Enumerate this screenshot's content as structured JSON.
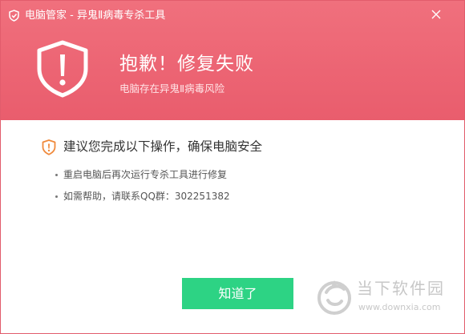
{
  "window": {
    "title": "电脑管家 - 异鬼Ⅱ病毒专杀工具",
    "app_icon": "shield-icon",
    "close_icon": "close-icon"
  },
  "header": {
    "headline": "抱歉！修复失败",
    "subline": "电脑存在异鬼Ⅱ病毒风险",
    "icon": "shield-exclamation-icon"
  },
  "advice": {
    "icon": "warning-shield-icon",
    "text": "建议您完成以下操作，确保电脑安全",
    "steps": [
      "重启电脑后再次运行专杀工具进行修复",
      "如需帮助，请联系QQ群：302251382"
    ]
  },
  "actions": {
    "ok_label": "知道了"
  },
  "watermark": {
    "name": "当下软件园",
    "url": "www.downxia.com"
  },
  "colors": {
    "header_bg": "#ec6473",
    "button_bg": "#2dd384",
    "warning_orange": "#f08a3c",
    "text_dark": "#333333"
  }
}
